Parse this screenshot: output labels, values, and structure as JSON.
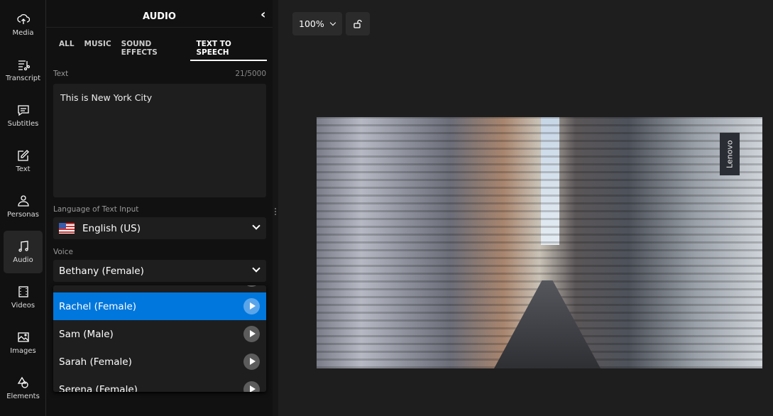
{
  "rail": [
    {
      "label": "Media",
      "icon": "cloud-upload-icon"
    },
    {
      "label": "Transcript",
      "icon": "transcript-scissors-icon"
    },
    {
      "label": "Subtitles",
      "icon": "chat-bubble-icon"
    },
    {
      "label": "Text",
      "icon": "edit-icon"
    },
    {
      "label": "Personas",
      "icon": "person-icon"
    },
    {
      "label": "Audio",
      "icon": "music-note-icon",
      "active": true
    },
    {
      "label": "Videos",
      "icon": "film-icon"
    },
    {
      "label": "Images",
      "icon": "image-icon"
    },
    {
      "label": "Elements",
      "icon": "shapes-icon"
    }
  ],
  "panel": {
    "title": "AUDIO",
    "tabs": [
      {
        "label": "ALL"
      },
      {
        "label": "MUSIC"
      },
      {
        "label": "SOUND EFFECTS"
      },
      {
        "label": "TEXT TO SPEECH",
        "active": true
      }
    ],
    "text_label": "Text",
    "text_count": "21/5000",
    "text_value": "This is New York City",
    "language_label": "Language of Text Input",
    "language_value": "English (US)",
    "voice_label": "Voice",
    "voice_value": "Bethany (Female)",
    "voice_options": [
      "Rachel (Female)",
      "Sam (Male)",
      "Sarah (Female)",
      "Serena (Female)"
    ],
    "highlighted_option": "Rachel (Female)"
  },
  "canvas": {
    "zoom": "100%",
    "video_sign": "Lenovo"
  },
  "colors": {
    "accent": "#0077dd"
  }
}
